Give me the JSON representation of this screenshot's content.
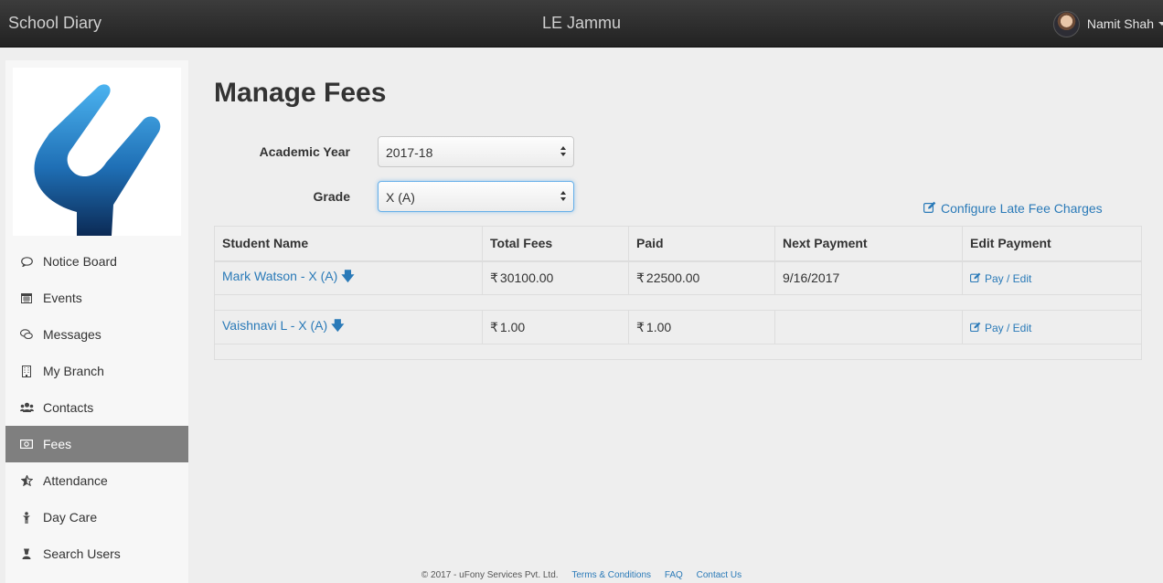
{
  "app": {
    "brand": "School Diary",
    "school": "LE Jammu",
    "user_name": "Namit Shah"
  },
  "sidebar": {
    "items": [
      {
        "label": "Notice Board",
        "icon": "comment-icon"
      },
      {
        "label": "Events",
        "icon": "calendar-icon"
      },
      {
        "label": "Messages",
        "icon": "chat-icon"
      },
      {
        "label": "My Branch",
        "icon": "building-icon"
      },
      {
        "label": "Contacts",
        "icon": "users-icon"
      },
      {
        "label": "Fees",
        "icon": "money-icon",
        "active": true
      },
      {
        "label": "Attendance",
        "icon": "star-icon"
      },
      {
        "label": "Day Care",
        "icon": "child-icon"
      },
      {
        "label": "Search Users",
        "icon": "user-search-icon"
      }
    ]
  },
  "main": {
    "title": "Manage Fees",
    "academic_year_label": "Academic Year",
    "academic_year_value": "2017-18",
    "grade_label": "Grade",
    "grade_value": "X (A)",
    "late_fee_link": "Configure Late Fee Charges"
  },
  "table": {
    "headers": [
      "Student Name",
      "Total Fees",
      "Paid",
      "Next Payment",
      "Edit Payment"
    ],
    "currency_symbol": "₹",
    "rows": [
      {
        "student": "Mark Watson - X (A)",
        "total": "30100.00",
        "paid": "22500.00",
        "next_payment": "9/16/2017",
        "action": "Pay / Edit"
      },
      {
        "student": "Vaishnavi L - X (A)",
        "total": "1.00",
        "paid": "1.00",
        "next_payment": "",
        "action": "Pay / Edit"
      }
    ]
  },
  "footer": {
    "copyright": "© 2017 - uFony Services Pvt. Ltd.",
    "terms": "Terms & Conditions",
    "faq": "FAQ",
    "contact": "Contact Us"
  },
  "colors": {
    "link": "#2a7ab8",
    "active_nav": "#7f7f7f",
    "topbar": "#2b2b2b"
  }
}
